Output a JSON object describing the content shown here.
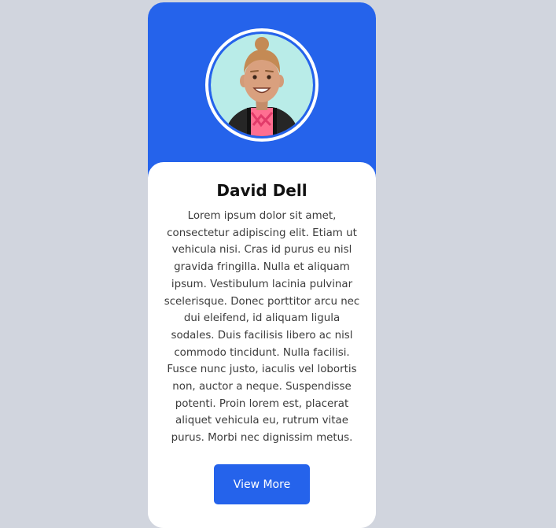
{
  "profile": {
    "name": "David Dell",
    "bio": "Lorem ipsum dolor sit amet, consectetur adipiscing elit. Etiam ut vehicula nisi. Cras id purus eu nisl gravida fringilla. Nulla et aliquam ipsum. Vestibulum lacinia pulvinar scelerisque. Donec porttitor arcu nec dui eleifend, id aliquam ligula sodales. Duis facilisis libero ac nisl commodo tincidunt. Nulla facilisi. Fusce nunc justo, iaculis vel lobortis non, auctor a neque. Suspendisse potenti. Proin lorem est, placerat aliquet vehicula eu, rutrum vitae purus. Morbi nec dignissim metus.",
    "button_label": "View More",
    "avatar_icon": "person-avatar-icon"
  },
  "colors": {
    "accent": "#2563eb",
    "page_background": "#d1d5de",
    "card_background": "#ffffff",
    "avatar_background": "#b9ece8"
  }
}
